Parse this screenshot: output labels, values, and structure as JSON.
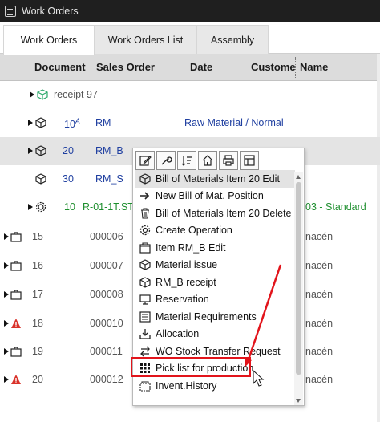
{
  "window": {
    "title": "Work Orders"
  },
  "tabs": [
    {
      "label": "Work Orders",
      "active": true
    },
    {
      "label": "Work Orders List",
      "active": false
    },
    {
      "label": "Assembly",
      "active": false
    }
  ],
  "columns": {
    "document": "Document",
    "sales_order": "Sales Order",
    "date": "Date",
    "customer": "Custome",
    "name": "Name"
  },
  "rows": [
    {
      "doc": "receipt 97"
    },
    {
      "doc": "10",
      "sup": "A",
      "so": "RM",
      "name": "Raw Material / Normal"
    },
    {
      "doc": "20",
      "so": "RM_B"
    },
    {
      "doc": "30",
      "so": "RM_S"
    },
    {
      "doc": "10",
      "so": "R-01-1T.ST",
      "name": "03 - Standard"
    },
    {
      "doc": "15",
      "so": "000006",
      "name": "nacén"
    },
    {
      "doc": "16",
      "so": "000007",
      "name": "nacén"
    },
    {
      "doc": "17",
      "so": "000008",
      "name": "nacén"
    },
    {
      "doc": "18",
      "so": "000010",
      "name": "nacén"
    },
    {
      "doc": "19",
      "so": "000011",
      "name": "nacén"
    },
    {
      "doc": "20",
      "so": "000012",
      "name": "nacén"
    }
  ],
  "context_menu": {
    "toolbar": [
      "edit-icon",
      "wrench-icon",
      "sort-icon",
      "home-icon",
      "print-icon",
      "layout-icon"
    ],
    "items": [
      {
        "label": "Bill of Materials Item 20 Edit",
        "icon": "cube-icon"
      },
      {
        "label": "New Bill of Mat. Position",
        "icon": "arrow-right-icon"
      },
      {
        "label": "Bill of Materials Item 20 Delete",
        "icon": "trash-icon"
      },
      {
        "label": "Create Operation",
        "icon": "gear-icon"
      },
      {
        "label": "Item RM_B Edit",
        "icon": "item-icon"
      },
      {
        "label": "Material issue",
        "icon": "cube-icon"
      },
      {
        "label": "RM_B receipt",
        "icon": "cube-icon"
      },
      {
        "label": "Reservation",
        "icon": "monitor-icon"
      },
      {
        "label": "Material Requirements",
        "icon": "list-icon"
      },
      {
        "label": "Allocation",
        "icon": "download-icon"
      },
      {
        "label": "WO Stock Transfer Request",
        "icon": "transfer-icon"
      },
      {
        "label": "Pick list for production",
        "icon": "grid-icon"
      },
      {
        "label": "Invent.History",
        "icon": "history-icon"
      }
    ]
  },
  "colors": {
    "highlight": "#e2141b",
    "link_blue": "#1f3fa0",
    "green": "#1f8f2f"
  }
}
